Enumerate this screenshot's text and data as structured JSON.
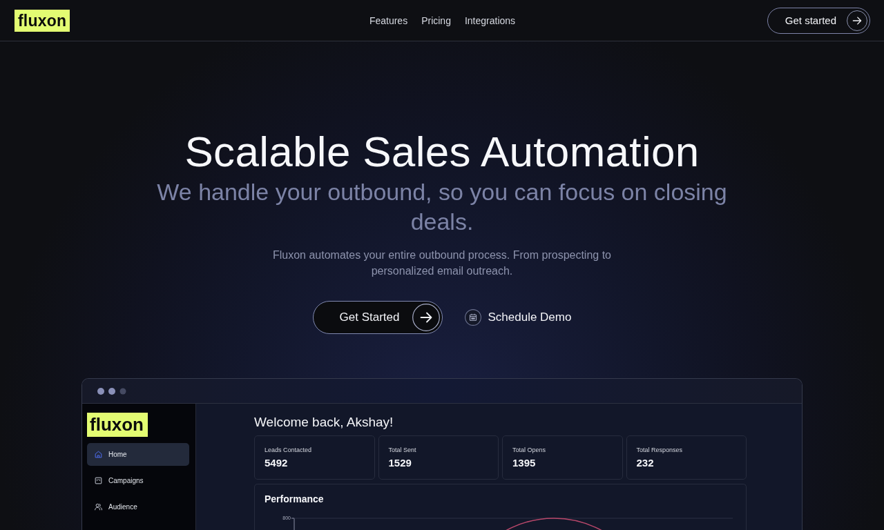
{
  "nav": {
    "logo": "fluxon",
    "links": [
      {
        "label": "Features"
      },
      {
        "label": "Pricing"
      },
      {
        "label": "Integrations"
      }
    ],
    "cta": "Get started"
  },
  "hero": {
    "title": "Scalable Sales Automation",
    "subtitle": "We handle your outbound, so you can focus on closing deals.",
    "description": "Fluxon automates your entire outbound process. From prospecting to personalized email outreach.",
    "primary_button": "Get Started",
    "secondary_button": "Schedule Demo"
  },
  "dashboard": {
    "sidebar": {
      "logo": "fluxon",
      "items": [
        {
          "label": "Home",
          "kind": "home",
          "selected": true
        },
        {
          "label": "Campaigns",
          "kind": "board",
          "selected": false
        },
        {
          "label": "Audience",
          "kind": "users",
          "selected": false
        }
      ]
    },
    "greeting": "Welcome back, Akshay!",
    "stats": [
      {
        "label": "Leads Contacted",
        "value": "5492"
      },
      {
        "label": "Total Sent",
        "value": "1529"
      },
      {
        "label": "Total Opens",
        "value": "1395"
      },
      {
        "label": "Total Responses",
        "value": "232"
      }
    ],
    "performance": {
      "title": "Performance",
      "y_tick": "800"
    }
  }
}
